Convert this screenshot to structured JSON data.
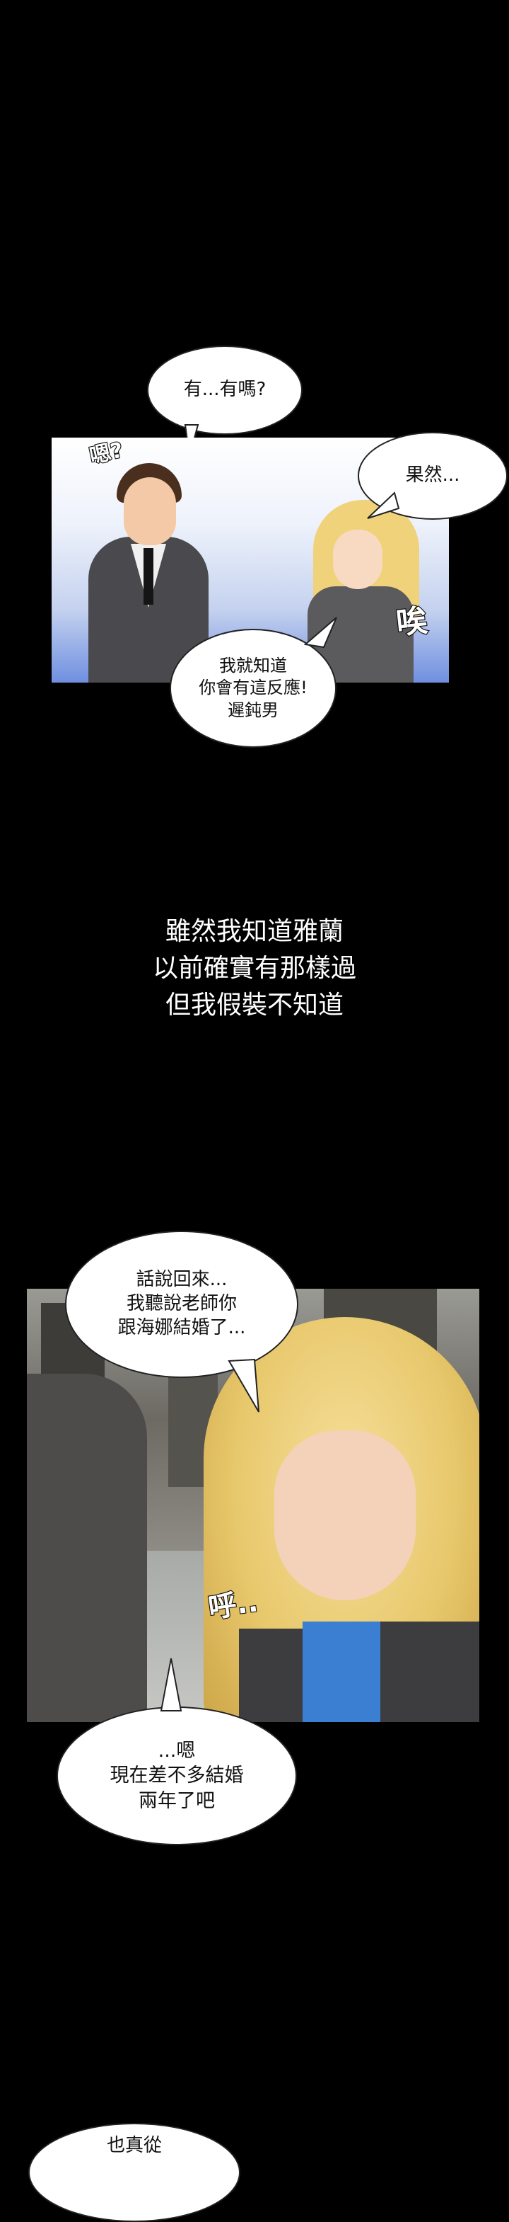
{
  "panel1": {
    "bubble_question": "有...有嗎?",
    "bubble_knew": "果然...",
    "bubble_retort": "我就知道\n你會有這反應!\n遲鈍男",
    "sfx_hmm": "嗯?",
    "sfx_sigh": "唉"
  },
  "narration": {
    "text": "雖然我知道雅蘭\n以前確實有那樣過\n但我假裝不知道"
  },
  "panel2": {
    "bubble_ask": "話說回來...\n我聽說老師你\n跟海娜結婚了...",
    "bubble_answer": "...嗯\n現在差不多結婚\n兩年了吧",
    "sfx_breath": "呼.."
  },
  "bottom": {
    "bubble_partial": "也真從"
  }
}
